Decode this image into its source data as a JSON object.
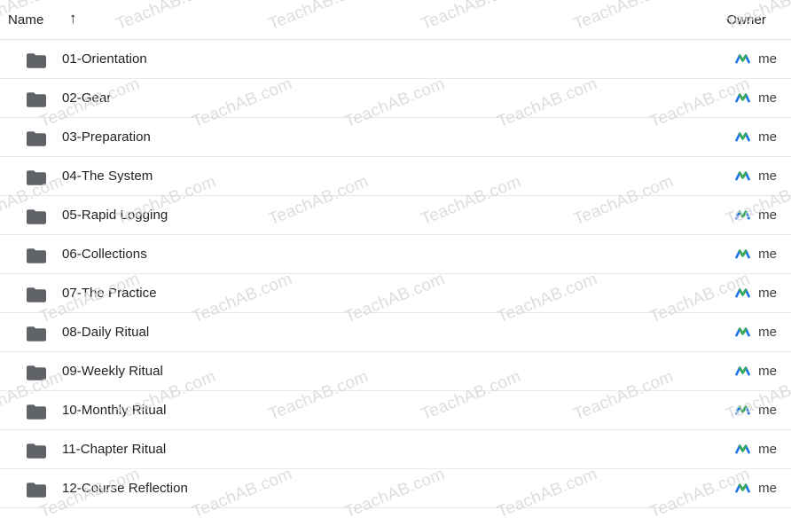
{
  "header": {
    "name_label": "Name",
    "sort_arrow": "↑",
    "owner_label": "Owner"
  },
  "watermark": {
    "text": "TeachAB.com",
    "color": "#d8d8d8",
    "angle_deg": -22
  },
  "colors": {
    "folder_icon": "#5f6368",
    "text_primary": "#202124",
    "text_secondary": "#3c4043",
    "divider": "#e8e8e8",
    "avatar_blue": "#1a73e8",
    "avatar_green": "#34a853",
    "background": "#ffffff"
  },
  "rows": [
    {
      "name": "01-Orientation",
      "owner": "me",
      "icon": "folder-icon",
      "owner_icon": "owner-avatar-icon"
    },
    {
      "name": "02-Gear",
      "owner": "me",
      "icon": "folder-icon",
      "owner_icon": "owner-avatar-icon"
    },
    {
      "name": "03-Preparation",
      "owner": "me",
      "icon": "folder-icon",
      "owner_icon": "owner-avatar-icon"
    },
    {
      "name": "04-The System",
      "owner": "me",
      "icon": "folder-icon",
      "owner_icon": "owner-avatar-icon"
    },
    {
      "name": "05-Rapid Logging",
      "owner": "me",
      "icon": "folder-icon",
      "owner_icon": "owner-avatar-icon"
    },
    {
      "name": "06-Collections",
      "owner": "me",
      "icon": "folder-icon",
      "owner_icon": "owner-avatar-icon"
    },
    {
      "name": "07-The Practice",
      "owner": "me",
      "icon": "folder-icon",
      "owner_icon": "owner-avatar-icon"
    },
    {
      "name": "08-Daily Ritual",
      "owner": "me",
      "icon": "folder-icon",
      "owner_icon": "owner-avatar-icon"
    },
    {
      "name": "09-Weekly Ritual",
      "owner": "me",
      "icon": "folder-icon",
      "owner_icon": "owner-avatar-icon"
    },
    {
      "name": "10-Monthly Ritual",
      "owner": "me",
      "icon": "folder-icon",
      "owner_icon": "owner-avatar-icon"
    },
    {
      "name": "11-Chapter Ritual",
      "owner": "me",
      "icon": "folder-icon",
      "owner_icon": "owner-avatar-icon"
    },
    {
      "name": "12-Course Reflection",
      "owner": "me",
      "icon": "folder-icon",
      "owner_icon": "owner-avatar-icon"
    }
  ]
}
